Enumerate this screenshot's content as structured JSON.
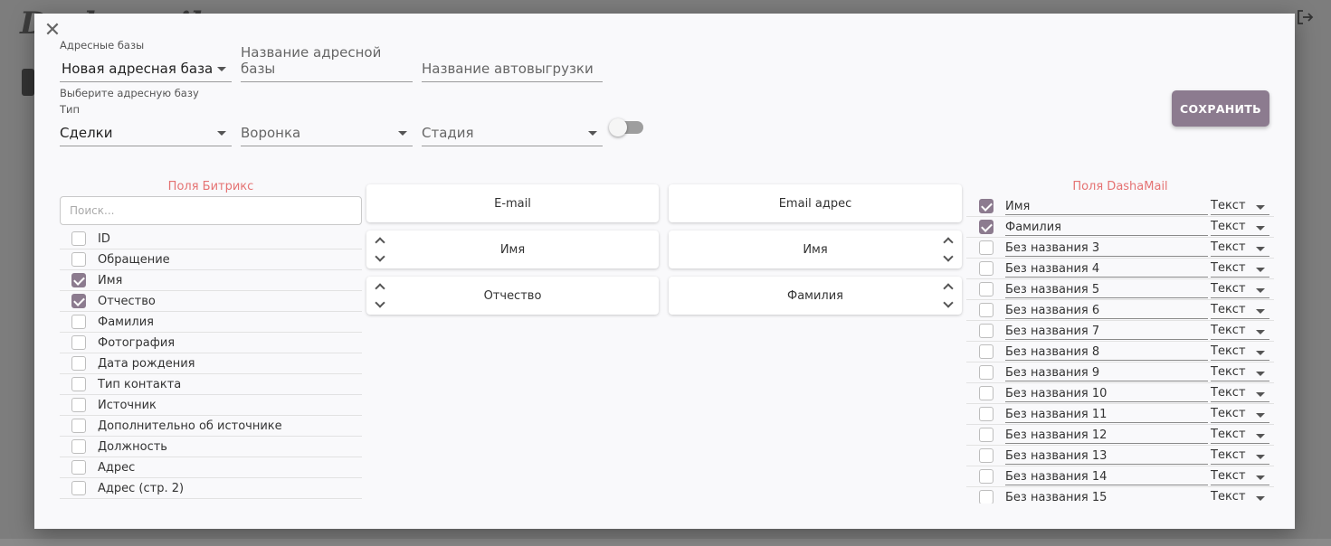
{
  "background": {
    "logo_text": "Dashamail",
    "accent_color": "#8c7b8f"
  },
  "modal": {
    "close_label": "✕",
    "address_base": {
      "label": "Адресные базы",
      "value": "Новая адресная база",
      "helper": "Выберите адресную базу",
      "name_placeholder": "Название адресной базы",
      "autoexport_placeholder": "Название автовыгрузки"
    },
    "type": {
      "label": "Тип",
      "value": "Сделки",
      "funnel_placeholder": "Воронка",
      "stage_placeholder": "Стадия"
    },
    "save_label": "СОХРАНИТЬ"
  },
  "bitrix": {
    "title": "Поля Битрикс",
    "search_placeholder": "Поиск...",
    "fields": [
      {
        "label": "ID",
        "checked": false
      },
      {
        "label": "Обращение",
        "checked": false
      },
      {
        "label": "Имя",
        "checked": true
      },
      {
        "label": "Отчество",
        "checked": true
      },
      {
        "label": "Фамилия",
        "checked": false
      },
      {
        "label": "Фотография",
        "checked": false
      },
      {
        "label": "Дата рождения",
        "checked": false
      },
      {
        "label": "Тип контакта",
        "checked": false
      },
      {
        "label": "Источник",
        "checked": false
      },
      {
        "label": "Дополнительно об источнике",
        "checked": false
      },
      {
        "label": "Должность",
        "checked": false
      },
      {
        "label": "Адрес",
        "checked": false
      },
      {
        "label": "Адрес (стр. 2)",
        "checked": false
      }
    ]
  },
  "mapping": {
    "left": [
      "E-mail",
      "Имя",
      "Отчество"
    ],
    "right": [
      "Email адрес",
      "Имя",
      "Фамилия"
    ]
  },
  "dashamail": {
    "title": "Поля DashaMail",
    "fields": [
      {
        "label": "Имя",
        "type": "Текст",
        "checked": true
      },
      {
        "label": "Фамилия",
        "type": "Текст",
        "checked": true
      },
      {
        "label": "Без названия 3",
        "type": "Текст",
        "checked": false
      },
      {
        "label": "Без названия 4",
        "type": "Текст",
        "checked": false
      },
      {
        "label": "Без названия 5",
        "type": "Текст",
        "checked": false
      },
      {
        "label": "Без названия 6",
        "type": "Текст",
        "checked": false
      },
      {
        "label": "Без названия 7",
        "type": "Текст",
        "checked": false
      },
      {
        "label": "Без названия 8",
        "type": "Текст",
        "checked": false
      },
      {
        "label": "Без названия 9",
        "type": "Текст",
        "checked": false
      },
      {
        "label": "Без названия 10",
        "type": "Текст",
        "checked": false
      },
      {
        "label": "Без названия 11",
        "type": "Текст",
        "checked": false
      },
      {
        "label": "Без названия 12",
        "type": "Текст",
        "checked": false
      },
      {
        "label": "Без названия 13",
        "type": "Текст",
        "checked": false
      },
      {
        "label": "Без названия 14",
        "type": "Текст",
        "checked": false
      },
      {
        "label": "Без названия 15",
        "type": "Текст",
        "checked": false
      }
    ]
  }
}
